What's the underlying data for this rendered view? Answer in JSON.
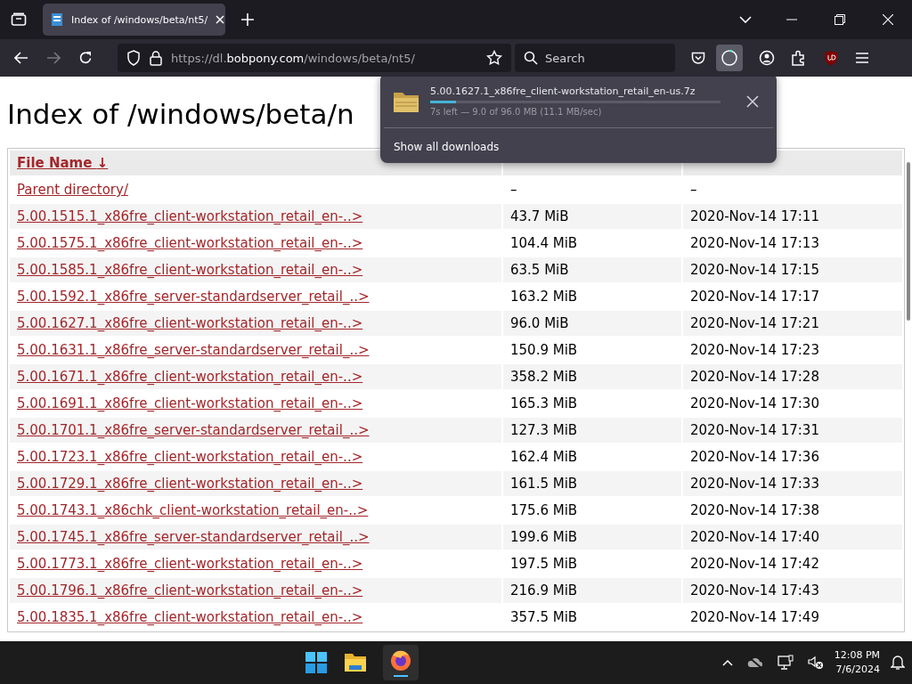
{
  "tab": {
    "title": "Index of /windows/beta/nt5/",
    "selected": true
  },
  "address": {
    "prefix": "https://dl.",
    "domain": "bobpony.com",
    "path": "/windows/beta/nt5/"
  },
  "search": {
    "placeholder": "Search"
  },
  "page": {
    "heading": "Index of /windows/beta/n",
    "columns": [
      {
        "label": "File Name",
        "sort": "↓"
      },
      {},
      {}
    ],
    "rows": [
      {
        "name": "Parent directory/",
        "size": "–",
        "date": "–"
      },
      {
        "name": "5.00.1515.1_x86fre_client-workstation_retail_en-..>",
        "size": "43.7 MiB",
        "date": "2020-Nov-14 17:11"
      },
      {
        "name": "5.00.1575.1_x86fre_client-workstation_retail_en-..>",
        "size": "104.4 MiB",
        "date": "2020-Nov-14 17:13"
      },
      {
        "name": "5.00.1585.1_x86fre_client-workstation_retail_en-..>",
        "size": "63.5 MiB",
        "date": "2020-Nov-14 17:15"
      },
      {
        "name": "5.00.1592.1_x86fre_server-standardserver_retail_..>",
        "size": "163.2 MiB",
        "date": "2020-Nov-14 17:17"
      },
      {
        "name": "5.00.1627.1_x86fre_client-workstation_retail_en-..>",
        "size": "96.0 MiB",
        "date": "2020-Nov-14 17:21"
      },
      {
        "name": "5.00.1631.1_x86fre_server-standardserver_retail_..>",
        "size": "150.9 MiB",
        "date": "2020-Nov-14 17:23"
      },
      {
        "name": "5.00.1671.1_x86fre_client-workstation_retail_en-..>",
        "size": "358.2 MiB",
        "date": "2020-Nov-14 17:28"
      },
      {
        "name": "5.00.1691.1_x86fre_client-workstation_retail_en-..>",
        "size": "165.3 MiB",
        "date": "2020-Nov-14 17:30"
      },
      {
        "name": "5.00.1701.1_x86fre_server-standardserver_retail_..>",
        "size": "127.3 MiB",
        "date": "2020-Nov-14 17:31"
      },
      {
        "name": "5.00.1723.1_x86fre_client-workstation_retail_en-..>",
        "size": "162.4 MiB",
        "date": "2020-Nov-14 17:36"
      },
      {
        "name": "5.00.1729.1_x86fre_client-workstation_retail_en-..>",
        "size": "161.5 MiB",
        "date": "2020-Nov-14 17:33"
      },
      {
        "name": "5.00.1743.1_x86chk_client-workstation_retail_en-..>",
        "size": "175.6 MiB",
        "date": "2020-Nov-14 17:38"
      },
      {
        "name": "5.00.1745.1_x86fre_server-standardserver_retail_..>",
        "size": "199.6 MiB",
        "date": "2020-Nov-14 17:40"
      },
      {
        "name": "5.00.1773.1_x86fre_client-workstation_retail_en-..>",
        "size": "197.5 MiB",
        "date": "2020-Nov-14 17:42"
      },
      {
        "name": "5.00.1796.1_x86fre_client-workstation_retail_en-..>",
        "size": "216.9 MiB",
        "date": "2020-Nov-14 17:43"
      },
      {
        "name": "5.00.1835.1_x86fre_client-workstation_retail_en-..>",
        "size": "357.5 MiB",
        "date": "2020-Nov-14 17:49"
      }
    ]
  },
  "download": {
    "file": "5.00.1627.1_x86fre_client-workstation_retail_en-us.7z",
    "level": 0.09,
    "status": "7s left — 9.0 of 96.0 MB (11.1 MB/sec)",
    "show_all": "Show all downloads"
  },
  "taskbar": {
    "time": "12:08 PM",
    "date": "7/6/2024"
  }
}
